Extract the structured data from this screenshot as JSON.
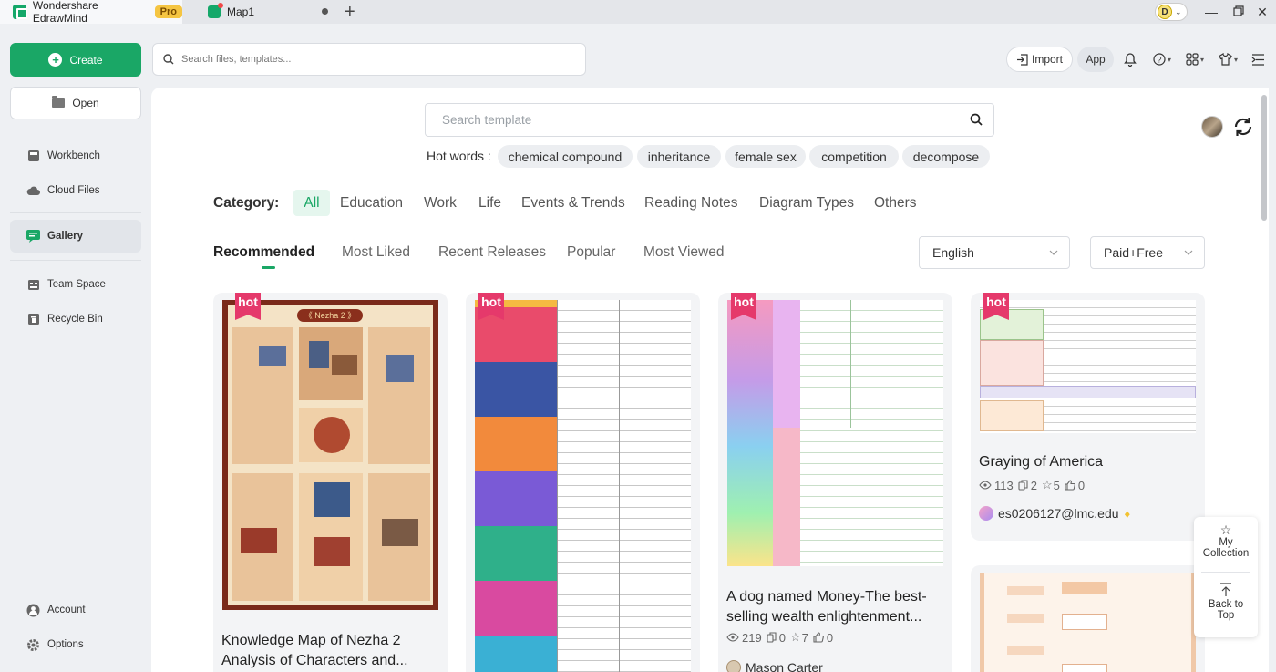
{
  "titlebar": {
    "app_name": "Wondershare EdrawMind",
    "pro_badge": "Pro",
    "doc_tab": "Map1",
    "user_initial": "D"
  },
  "sidebar": {
    "create_label": "Create",
    "open_label": "Open",
    "items": [
      {
        "label": "Workbench",
        "icon": "workbench-icon"
      },
      {
        "label": "Cloud Files",
        "icon": "cloud-icon"
      },
      {
        "label": "Gallery",
        "icon": "gallery-icon"
      },
      {
        "label": "Team Space",
        "icon": "team-space-icon"
      },
      {
        "label": "Recycle Bin",
        "icon": "recycle-bin-icon"
      },
      {
        "label": "Account",
        "icon": "account-icon"
      },
      {
        "label": "Options",
        "icon": "options-gear-icon"
      }
    ]
  },
  "topbar": {
    "search_placeholder": "Search files, templates...",
    "import_label": "Import",
    "app_label": "App"
  },
  "gallery": {
    "template_search_placeholder": "Search template",
    "hot_words_label": "Hot words :",
    "hot_words": [
      "chemical compound",
      "inheritance",
      "female sex",
      "competition",
      "decompose"
    ],
    "category_label": "Category:",
    "categories": [
      "All",
      "Education",
      "Work",
      "Life",
      "Events & Trends",
      "Reading Notes",
      "Diagram Types",
      "Others"
    ],
    "sort_tabs": [
      "Recommended",
      "Most Liked",
      "Recent Releases",
      "Popular",
      "Most Viewed"
    ],
    "language_select": "English",
    "price_select": "Paid+Free",
    "hot_badge": "hot"
  },
  "cards": [
    {
      "title": "Knowledge Map of Nezha 2 Analysis of Characters and...",
      "thumb_title": "《 Nezha 2 》"
    },
    {
      "title": ""
    },
    {
      "title": "A dog named Money-The best-selling wealth enlightenment...",
      "views": "219",
      "copies": "0",
      "stars": "7",
      "likes": "0",
      "author": "Mason Carter"
    },
    {
      "title": "Graying of America",
      "views": "113",
      "copies": "2",
      "stars": "5",
      "likes": "0",
      "author": "es0206127@lmc.edu"
    }
  ],
  "float_panel": {
    "collection_label_1": "My",
    "collection_label_2": "Collection",
    "top_label_1": "Back to",
    "top_label_2": "Top"
  },
  "colors": {
    "accent": "#1aa766",
    "hot": "#e5396b",
    "pro": "#f5c542"
  }
}
